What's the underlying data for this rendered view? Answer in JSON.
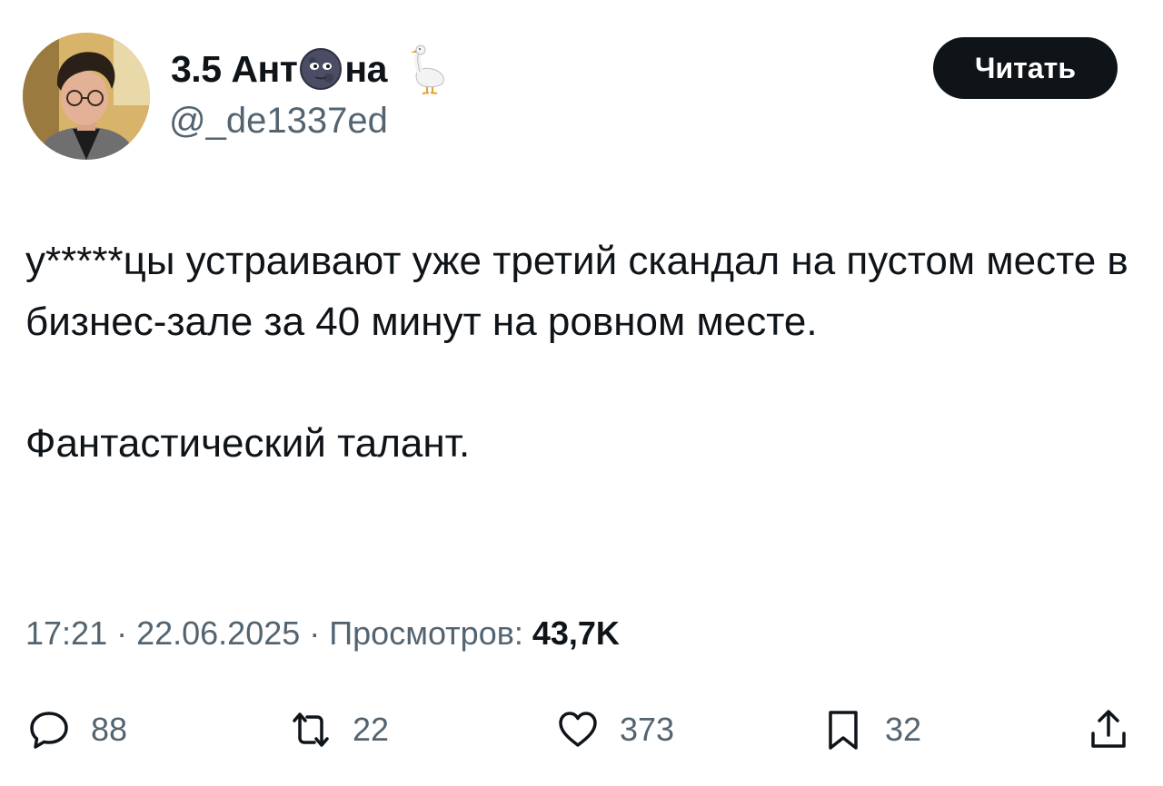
{
  "header": {
    "name_part1": "3.5 Ант",
    "name_part2": "на",
    "moon_icon": "new-moon-face-emoji",
    "goose_icon": "goose-emoji",
    "handle": "@_de1337ed",
    "read_button_label": "Читать"
  },
  "tweet": {
    "paragraph1": "у*****цы устраивают уже третий скандал на пустом месте в бизнес-зале за 40 минут на ровном месте.",
    "paragraph2": "Фантастический талант."
  },
  "meta": {
    "time": "17:21",
    "separator": " · ",
    "date": "22.06.2025",
    "views_label": "Просмотров:",
    "views_count": "43,7K"
  },
  "actions": {
    "replies": "88",
    "reposts": "22",
    "likes": "373",
    "bookmarks": "32"
  },
  "colors": {
    "text": "#0f1419",
    "secondary": "#536471",
    "button_bg": "#0f1419",
    "button_text": "#ffffff"
  }
}
